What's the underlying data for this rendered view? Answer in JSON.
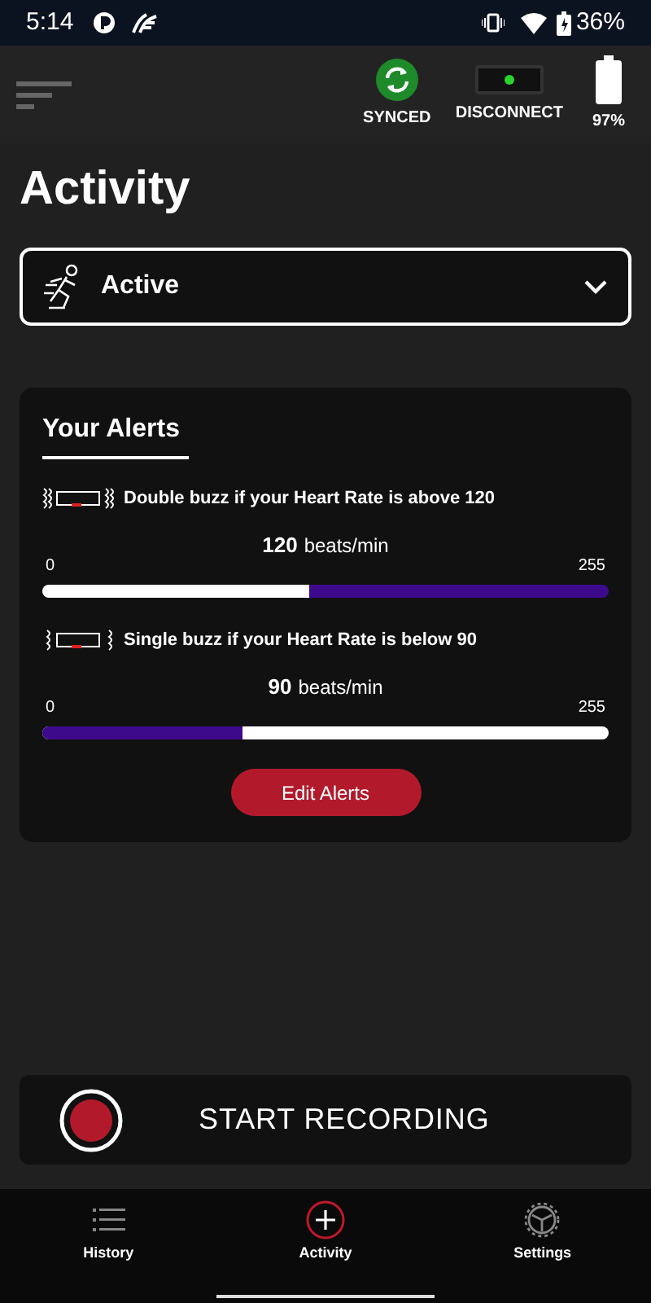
{
  "status_bar": {
    "time": "5:14",
    "battery": "36%"
  },
  "header": {
    "sync_label": "SYNCED",
    "device_label": "DISCONNECT",
    "device_battery": "97%"
  },
  "title": "Activity",
  "activity_select": {
    "value": "Active"
  },
  "alerts": {
    "title": "Your Alerts",
    "items": [
      {
        "kind": "above",
        "text": "Double buzz if your Heart Rate is above 120",
        "value": "120",
        "unit": "beats/min",
        "min": "0",
        "max": "255",
        "level": 0.47
      },
      {
        "kind": "below",
        "text": "Single buzz if your Heart Rate is below 90",
        "value": "90",
        "unit": "beats/min",
        "min": "0",
        "max": "255",
        "level": 0.353
      }
    ],
    "button": "Edit Alerts"
  },
  "record_button": "START RECORDING",
  "nav": [
    {
      "label": "History",
      "kind": "list",
      "selected": false
    },
    {
      "label": "Activity",
      "kind": "plus",
      "selected": true
    },
    {
      "label": "Settings",
      "kind": "gear",
      "selected": false
    }
  ]
}
